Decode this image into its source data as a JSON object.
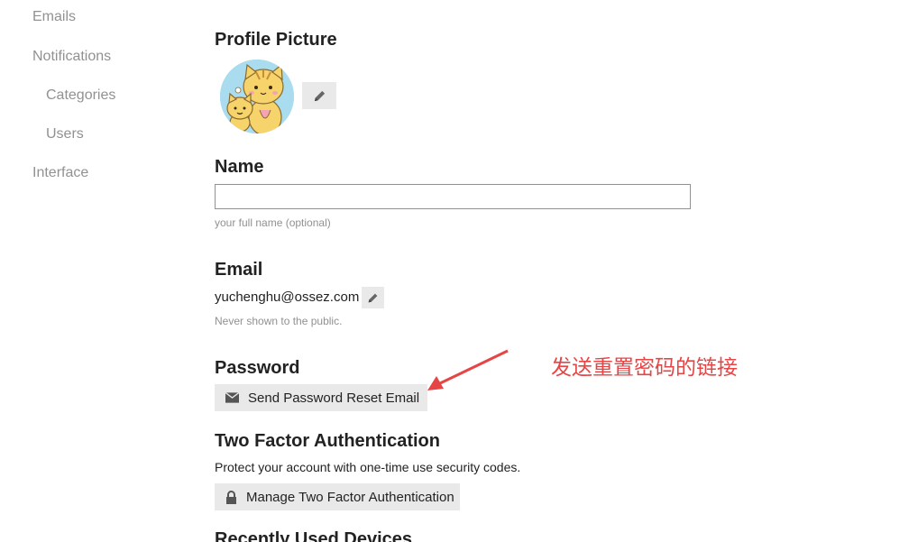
{
  "sidebar": {
    "items": [
      {
        "label": "Emails"
      },
      {
        "label": "Notifications"
      },
      {
        "label": "Categories"
      },
      {
        "label": "Users"
      },
      {
        "label": "Interface"
      }
    ]
  },
  "profile_picture": {
    "title": "Profile Picture",
    "edit_icon": "pencil-icon"
  },
  "name": {
    "title": "Name",
    "value": "",
    "placeholder": "",
    "hint": "your full name (optional)"
  },
  "email": {
    "title": "Email",
    "value": "yuchenghu@ossez.com",
    "edit_icon": "pencil-icon",
    "hint": "Never shown to the public."
  },
  "password": {
    "title": "Password",
    "reset_button_label": "Send Password Reset Email",
    "reset_button_icon": "envelope-icon"
  },
  "two_factor": {
    "title": "Two Factor Authentication",
    "description": "Protect your account with one-time use security codes.",
    "manage_button_label": "Manage Two Factor Authentication",
    "manage_button_icon": "lock-icon"
  },
  "recent_devices": {
    "title": "Recently Used Devices"
  },
  "annotation": {
    "text": "发送重置密码的链接",
    "color": "#e64545"
  },
  "colors": {
    "sidebar_text": "#919191",
    "heading_text": "#222222",
    "button_bg": "#e9e9e9",
    "hint_text": "#919191"
  }
}
